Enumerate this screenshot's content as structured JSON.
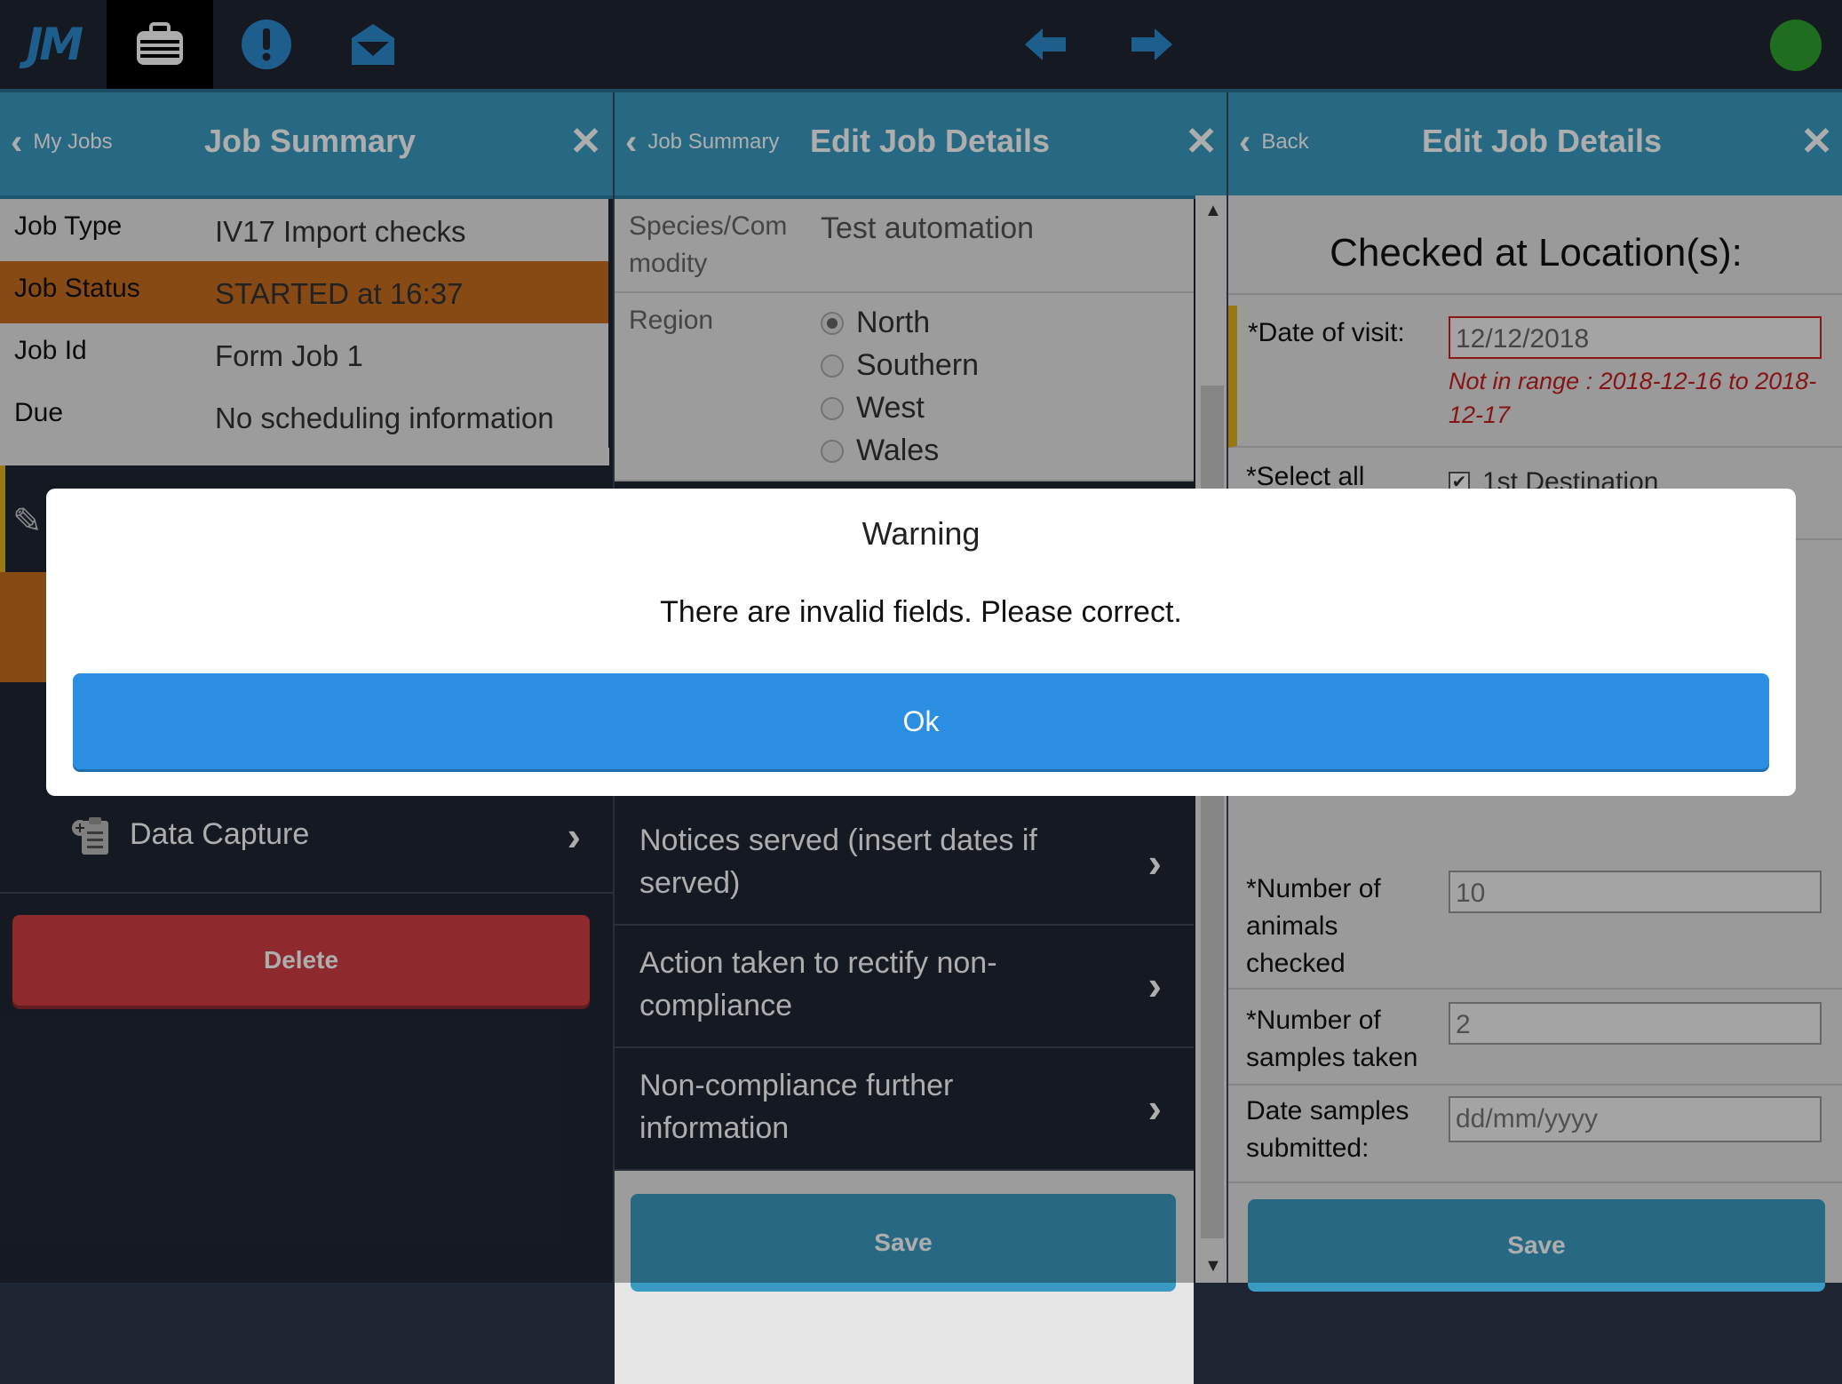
{
  "topbar": {
    "logo": "JM",
    "icons": [
      "briefcase-icon",
      "alert-icon",
      "mail-icon",
      "arrow-left-icon",
      "arrow-right-icon"
    ],
    "status_color": "#2ea32e"
  },
  "panel1": {
    "back_label": "My Jobs",
    "title": "Job Summary",
    "rows": [
      {
        "key": "Job Type",
        "value": "IV17 Import checks"
      },
      {
        "key": "Job Status",
        "value": "STARTED at 16:37"
      },
      {
        "key": "Job Id",
        "value": "Form Job 1"
      },
      {
        "key": "Due",
        "value": "No scheduling information"
      }
    ],
    "data_capture_label": "Data Capture",
    "delete_label": "Delete"
  },
  "panel2": {
    "back_label": "Job Summary",
    "title": "Edit Job Details",
    "species_label": "Species/Com modity",
    "species_value": "Test automation",
    "region_label": "Region",
    "regions": [
      "North",
      "Southern",
      "West",
      "Wales"
    ],
    "nav": [
      "Notices served (insert dates if served)",
      "Action taken to rectify non-compliance",
      "Non-compliance further information"
    ],
    "save_label": "Save"
  },
  "panel3": {
    "back_label": "Back",
    "title": "Edit Job Details",
    "section_title": "Checked at Location(s):",
    "date_visit_label": "*Date of visit:",
    "date_visit_value": "12/12/2018",
    "date_error": "Not in range : 2018-12-16 to 2018-12-17",
    "select_all_label": "*Select all",
    "dest_label": "1st Destination",
    "animals_label": "*Number of animals checked",
    "animals_value": "10",
    "samples_label": "*Number of samples taken",
    "samples_value": "2",
    "date_submitted_label": "Date samples submitted:",
    "date_submitted_placeholder": "dd/mm/yyyy",
    "save_label": "Save"
  },
  "modal": {
    "title": "Warning",
    "message": "There are invalid fields. Please correct.",
    "ok_label": "Ok"
  }
}
